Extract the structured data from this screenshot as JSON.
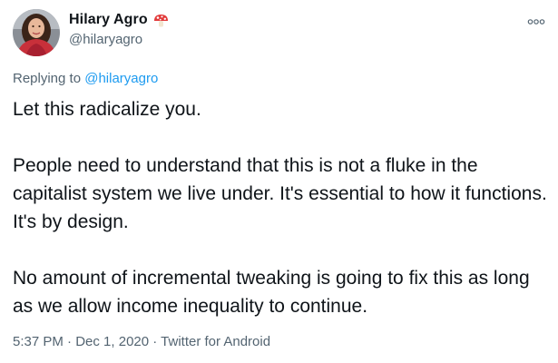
{
  "author": {
    "display_name": "Hilary Agro",
    "name_emoji": "mushroom-icon",
    "handle": "@hilaryagro"
  },
  "reply": {
    "prefix": "Replying to ",
    "mention": "@hilaryagro"
  },
  "tweet": {
    "paragraphs": [
      "Let this radicalize you.",
      "People need to understand that this is not a fluke in the capitalist system we live under. It's essential to how it functions. It's by design.",
      "No amount of incremental tweaking is going to fix this as long as we allow income inequality to continue."
    ]
  },
  "meta": {
    "time": "5:37 PM",
    "separator": " · ",
    "date": "Dec 1, 2020",
    "source": "Twitter for Android"
  },
  "colors": {
    "text": "#0f1419",
    "secondary": "#536471",
    "link": "#1d9bf0"
  }
}
